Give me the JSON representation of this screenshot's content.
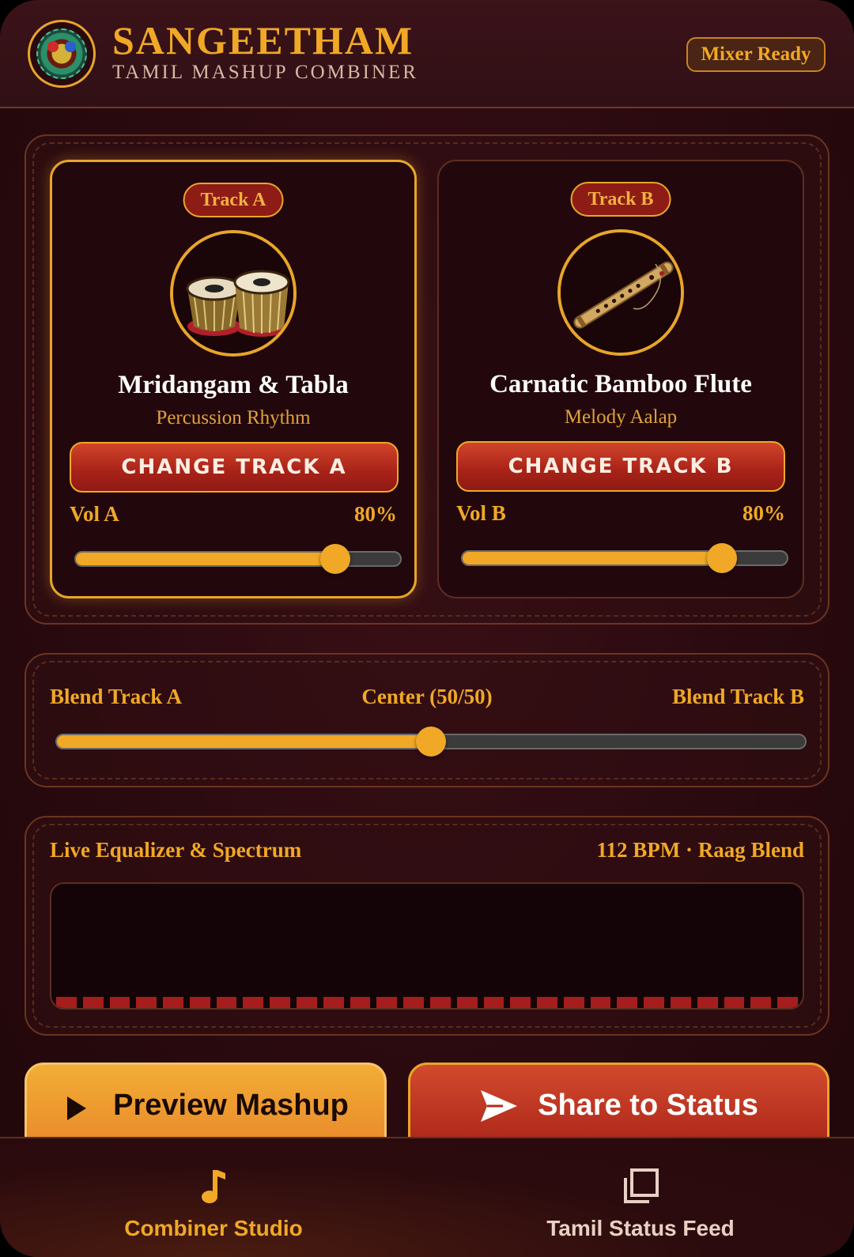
{
  "header": {
    "title": "SANGEETHAM",
    "subtitle": "TAMIL MASHUP COMBINER",
    "status": "Mixer Ready"
  },
  "tracks": [
    {
      "pill": "Track A",
      "name": "Mridangam & Tabla",
      "description": "Percussion Rhythm",
      "button": "CHANGE TRACK A",
      "volume_label": "Vol A",
      "volume_text": "80%",
      "volume": 0.8,
      "art_icon": "tabla-drums-icon"
    },
    {
      "pill": "Track B",
      "name": "Carnatic Bamboo Flute",
      "description": "Melody Aalap",
      "button": "CHANGE TRACK B",
      "volume_label": "Vol B",
      "volume_text": "80%",
      "volume": 0.8,
      "art_icon": "bamboo-flute-icon"
    }
  ],
  "blend": {
    "left_label": "Blend Track A",
    "center_label": "Center (50/50)",
    "right_label": "Blend Track B",
    "value": 0.5
  },
  "equalizer": {
    "title": "Live Equalizer & Spectrum",
    "info": "112 BPM · Raag Blend",
    "bar_count": 28
  },
  "actions": {
    "preview": "Preview Mashup",
    "share": "Share to Status"
  },
  "nav": [
    {
      "label": "Combiner Studio",
      "icon": "music-note-icon",
      "active": true
    },
    {
      "label": "Tamil Status Feed",
      "icon": "stacked-squares-icon",
      "active": false
    }
  ],
  "colors": {
    "accent": "#f0a826",
    "primary_red": "#a82218",
    "background": "#2a0a0f",
    "nav_inactive": "#e8d0c4"
  }
}
